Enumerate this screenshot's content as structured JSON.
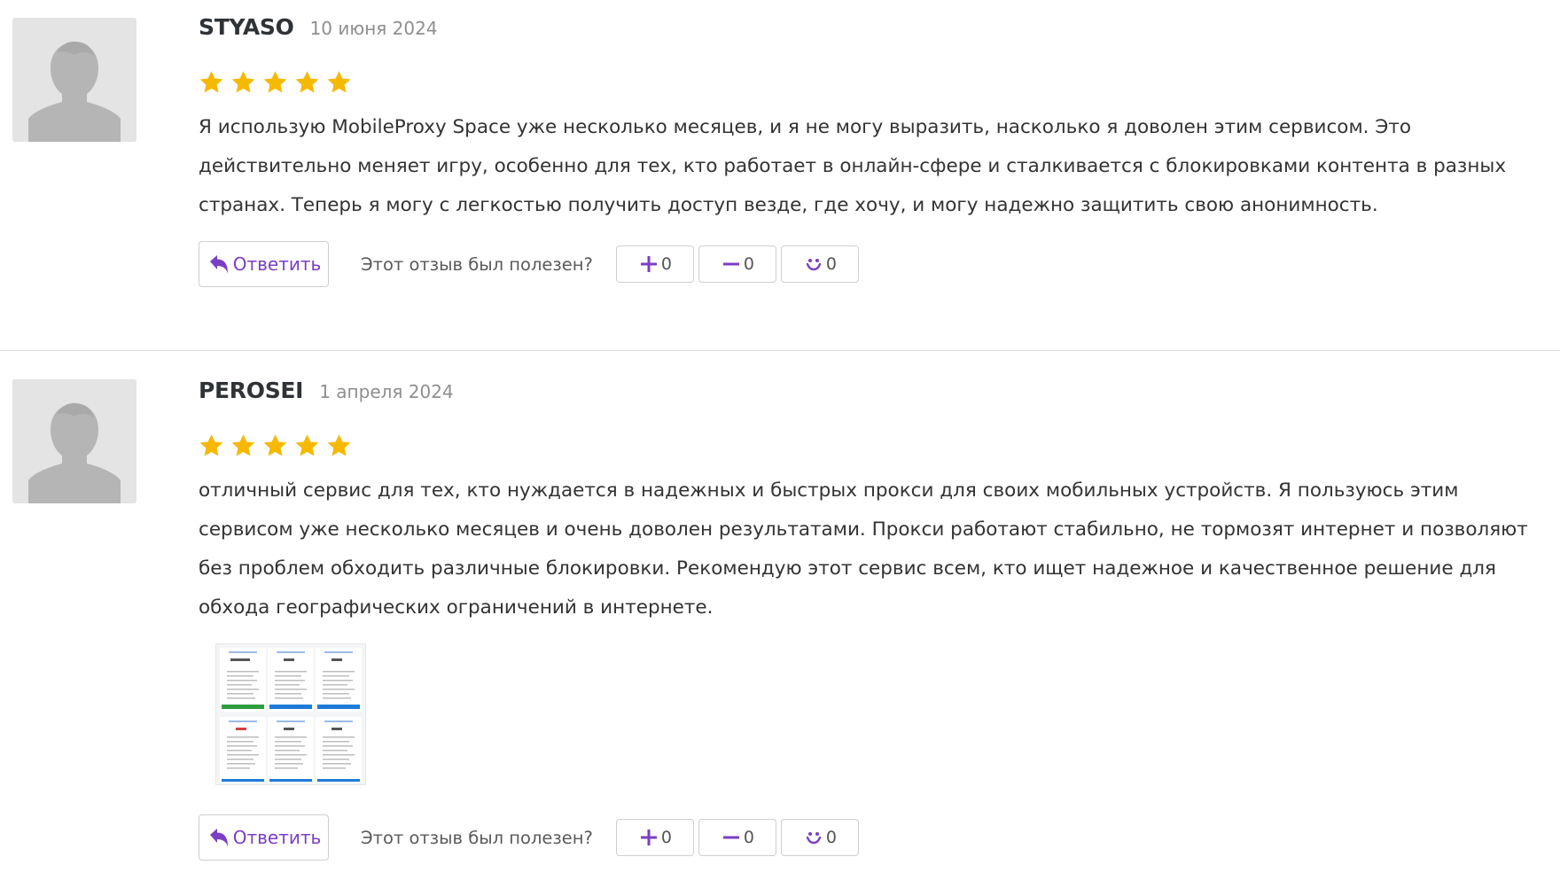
{
  "reviews": [
    {
      "author": "STYASO",
      "date": "10 июня 2024",
      "rating": 5,
      "text": "Я использую MobileProxy Space уже несколько месяцев, и я не могу выразить, насколько я доволен этим сервисом. Это действительно меняет игру, особенно для тех, кто работает в онлайн-сфере и сталкивается с блокировками контента в разных странах. Теперь я могу с легкостью получить доступ везде, где хочу, и могу надежно защитить свою анонимность.",
      "has_attachment": false,
      "reply_label": "Ответить",
      "helpful_label": "Этот отзыв был полезен?",
      "votes": {
        "plus": "0",
        "minus": "0",
        "funny": "0"
      }
    },
    {
      "author": "PEROSEI",
      "date": "1 апреля 2024",
      "rating": 5,
      "text": "отличный сервис для тех, кто нуждается в надежных и быстрых прокси для своих мобильных устройств. Я пользуюсь этим сервисом уже несколько месяцев и очень доволен результатами. Прокси работают стабильно, не тормозят интернет и позволяют без проблем обходить различные блокировки. Рекомендую этот сервис всем, кто ищет надежное и качественное решение для обхода географических ограничений в интернете.",
      "has_attachment": true,
      "reply_label": "Ответить",
      "helpful_label": "Этот отзыв был полезен?",
      "votes": {
        "plus": "0",
        "minus": "0",
        "funny": "0"
      }
    }
  ],
  "icons": {
    "avatar": "user-placeholder-icon",
    "star": "star-icon",
    "reply": "reply-arrow-icon",
    "plus": "plus-icon",
    "minus": "minus-icon",
    "funny": "smile-icon"
  },
  "colors": {
    "accent": "#7a3fc4",
    "star": "#f6b900",
    "author": "#2f3337",
    "date": "#8f8f8f",
    "border": "#cfcfcf"
  }
}
